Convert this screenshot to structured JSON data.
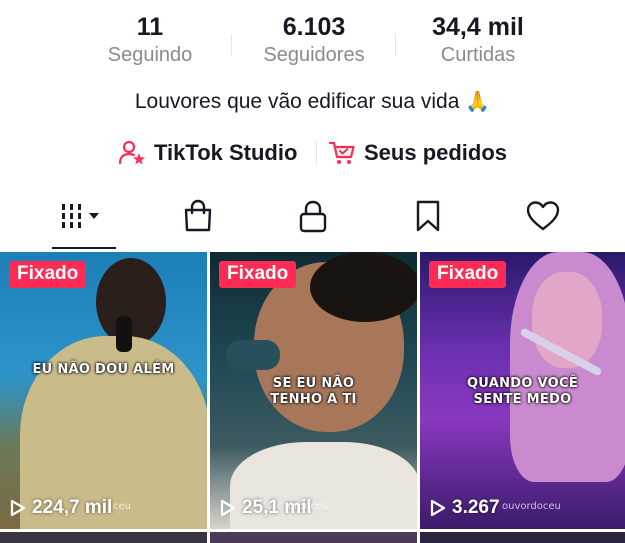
{
  "stats": [
    {
      "value": "11",
      "label": "Seguindo"
    },
    {
      "value": "6.103",
      "label": "Seguidores"
    },
    {
      "value": "34,4 mil",
      "label": "Curtidas"
    }
  ],
  "bio": {
    "text": "Louvores que vão edificar sua vida",
    "emoji": "🙏"
  },
  "links": {
    "studio": {
      "label": "TikTok Studio",
      "icon": "person-star-icon",
      "color": "#fe2c55"
    },
    "orders": {
      "label": "Seus pedidos",
      "icon": "cart-icon",
      "color": "#fe2c55"
    }
  },
  "tabs": [
    {
      "icon": "videos-grid-icon",
      "selected": true
    },
    {
      "icon": "shopping-bag-icon",
      "selected": false
    },
    {
      "icon": "lock-icon",
      "selected": false
    },
    {
      "icon": "bookmark-icon",
      "selected": false
    },
    {
      "icon": "heart-icon",
      "selected": false
    }
  ],
  "videos": [
    {
      "badge": "Fixado",
      "caption": "EU NÃO DOU ALÉM",
      "views": "224,7 mil",
      "watermark": "ceu"
    },
    {
      "badge": "Fixado",
      "caption": "SE EU NÃO TENHO A TI",
      "caption_line1": "SE EU NÃO",
      "caption_line2": "TENHO A TI",
      "views": "25,1 mil",
      "watermark": "ordoceu"
    },
    {
      "badge": "Fixado",
      "caption": "QUANDO VOCÊ SENTE MEDO",
      "caption_line1": "QUANDO VOCÊ",
      "caption_line2": "SENTE MEDO",
      "views": "3.267",
      "watermark": "ouvordoceu"
    }
  ],
  "colors": {
    "accent": "#fe2c55",
    "text": "#161823",
    "muted": "#8a8b91"
  }
}
